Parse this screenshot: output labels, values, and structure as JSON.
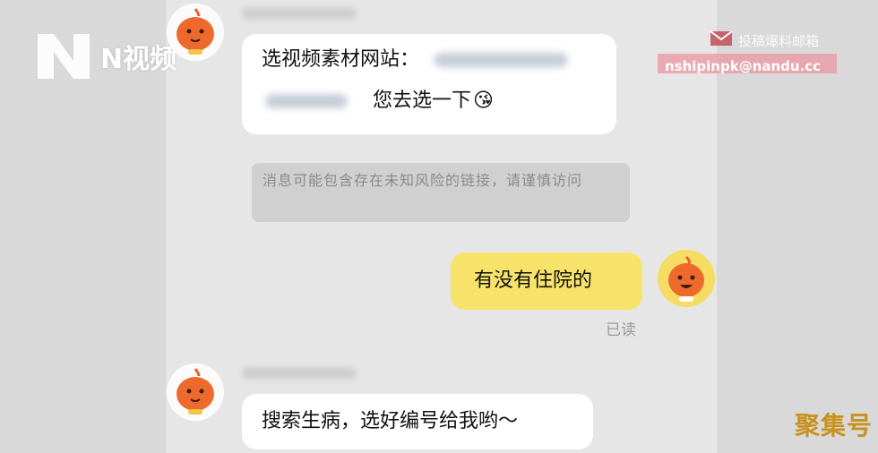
{
  "watermark": {
    "logo_text": "N视频",
    "tip_label": "投稿爆料邮箱",
    "tip_email": "nshipinpk@nandu.cc",
    "corner_brand": "聚集号",
    "colors": {
      "email_bg": "#e996a0",
      "corner_brand": "#c7921e"
    }
  },
  "chat": {
    "messages": [
      {
        "side": "left",
        "line1_text": "选视频素材网站：",
        "line2_text": "您去选一下",
        "emoji": "😘",
        "has_blurred_link": true
      },
      {
        "type": "system_warning",
        "text": "消息可能包含存在未知风险的链接，请谨慎访问"
      },
      {
        "side": "right",
        "text": "有没有住院的",
        "status": "已读"
      },
      {
        "side": "left",
        "text": "搜索生病，选好编号给我哟～"
      }
    ],
    "colors": {
      "self_bubble": "#f8e36a",
      "other_bubble": "#ffffff",
      "background": "#e6e6e6"
    }
  }
}
